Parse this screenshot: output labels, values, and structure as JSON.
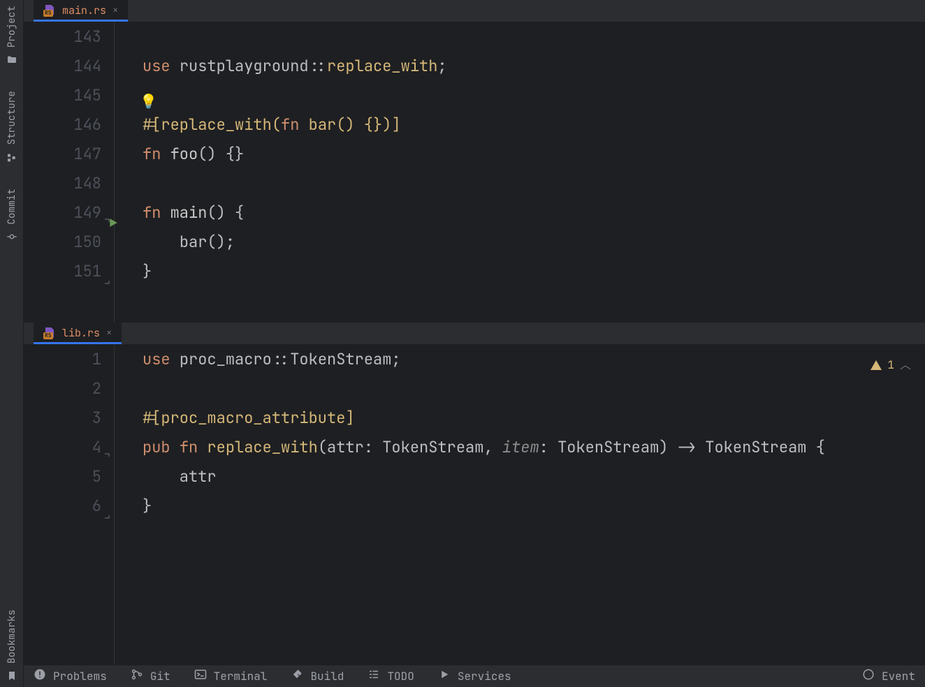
{
  "left_rail": {
    "top": [
      {
        "label": "Project",
        "icon": "folder"
      },
      {
        "label": "Structure",
        "icon": "structure"
      },
      {
        "label": "Commit",
        "icon": "commit"
      }
    ],
    "bottom": [
      {
        "label": "Bookmarks",
        "icon": "bookmark"
      }
    ]
  },
  "editors": {
    "top": {
      "tab": {
        "filename": "main.rs",
        "badge": "RS"
      },
      "lines": [
        {
          "n": 143,
          "tokens": []
        },
        {
          "n": 144,
          "tokens": [
            {
              "t": "use ",
              "c": "kw"
            },
            {
              "t": "rustplayground::",
              "c": "ident"
            },
            {
              "t": "replace_with",
              "c": "mac"
            },
            {
              "t": ";",
              "c": "punct"
            }
          ]
        },
        {
          "n": 145,
          "tokens": [],
          "bulb": true
        },
        {
          "n": 146,
          "tokens": [
            {
              "t": "#[",
              "c": "attr"
            },
            {
              "t": "replace_with",
              "c": "mac"
            },
            {
              "t": "(",
              "c": "attr"
            },
            {
              "t": "fn ",
              "c": "kw"
            },
            {
              "t": "bar",
              "c": "mac"
            },
            {
              "t": "() {}",
              "c": "attr"
            },
            {
              "t": ")",
              "c": "attr"
            },
            {
              "t": "]",
              "c": "attr"
            }
          ]
        },
        {
          "n": 147,
          "tokens": [
            {
              "t": "fn ",
              "c": "kw"
            },
            {
              "t": "foo",
              "c": "fnname"
            },
            {
              "t": "() {}",
              "c": "punct"
            }
          ]
        },
        {
          "n": 148,
          "tokens": []
        },
        {
          "n": 149,
          "run": true,
          "fold": "open",
          "tokens": [
            {
              "t": "fn ",
              "c": "kw"
            },
            {
              "t": "main",
              "c": "fnname"
            },
            {
              "t": "() {",
              "c": "punct"
            }
          ]
        },
        {
          "n": 150,
          "tokens": [
            {
              "t": "    ",
              "c": "punct"
            },
            {
              "t": "bar",
              "c": "ident"
            },
            {
              "t": "();",
              "c": "punct"
            }
          ]
        },
        {
          "n": 151,
          "fold": "close",
          "tokens": [
            {
              "t": "}",
              "c": "punct"
            }
          ]
        }
      ]
    },
    "bottom": {
      "tab": {
        "filename": "lib.rs",
        "badge": "RS"
      },
      "warn_count": "1",
      "lines": [
        {
          "n": 1,
          "tokens": [
            {
              "t": "use ",
              "c": "kw"
            },
            {
              "t": "proc_macro::TokenStream",
              "c": "ident"
            },
            {
              "t": ";",
              "c": "punct"
            }
          ]
        },
        {
          "n": 2,
          "tokens": []
        },
        {
          "n": 3,
          "tokens": [
            {
              "t": "#[",
              "c": "attr"
            },
            {
              "t": "proc_macro_attribute",
              "c": "mac"
            },
            {
              "t": "]",
              "c": "attr"
            }
          ]
        },
        {
          "n": 4,
          "hl": true,
          "fold": "open",
          "tokens": [
            {
              "t": "pub ",
              "c": "kw"
            },
            {
              "t": "fn ",
              "c": "kw"
            },
            {
              "t": "replace_with",
              "c": "mac"
            },
            {
              "t": "(attr: ",
              "c": "punct"
            },
            {
              "t": "TokenStream",
              "c": "type"
            },
            {
              "t": ", ",
              "c": "punct"
            },
            {
              "t": "item",
              "c": "param"
            },
            {
              "t": ": ",
              "c": "punct"
            },
            {
              "t": "TokenStream",
              "c": "type"
            },
            {
              "t": ") -> ",
              "c": "punct"
            },
            {
              "t": "TokenStream",
              "c": "type"
            },
            {
              "t": " {",
              "c": "punct"
            }
          ]
        },
        {
          "n": 5,
          "tokens": [
            {
              "t": "    attr",
              "c": "ident"
            }
          ]
        },
        {
          "n": 6,
          "fold": "close",
          "tokens": [
            {
              "t": "}",
              "c": "punct"
            }
          ]
        }
      ]
    }
  },
  "status": [
    {
      "label": "Problems",
      "icon": "problems"
    },
    {
      "label": "Git",
      "icon": "git"
    },
    {
      "label": "Terminal",
      "icon": "terminal"
    },
    {
      "label": "Build",
      "icon": "build"
    },
    {
      "label": "TODO",
      "icon": "todo"
    },
    {
      "label": "Services",
      "icon": "services"
    }
  ],
  "status_right": {
    "label": "Event",
    "icon": "event"
  }
}
